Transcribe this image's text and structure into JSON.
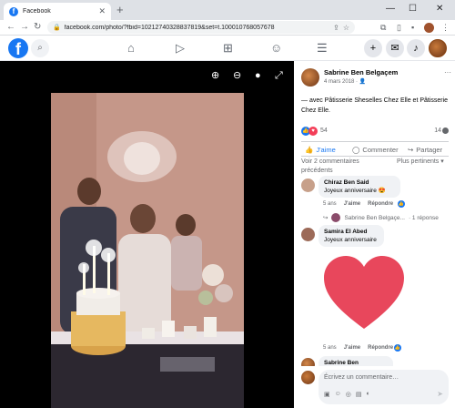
{
  "browser": {
    "tab_title": "Facebook",
    "tab_close": "✕",
    "new_tab": "+",
    "url": "facebook.com/photo/?fbid=10212740328837819&set=t.100010768057678",
    "minimize": "—",
    "maximize": "☐",
    "close": "✕"
  },
  "header": {
    "logo": "f",
    "nav_icons": [
      "home-icon",
      "watch-icon",
      "marketplace-icon",
      "groups-icon",
      "menu-icon"
    ]
  },
  "viewer": {
    "tools": [
      "zoom-in-icon",
      "zoom-out-icon",
      "tag-icon",
      "fullscreen-icon"
    ]
  },
  "post": {
    "author": "Sabrine Ben Belgaçem",
    "date": "4 mars 2018 · 👤",
    "more": "···",
    "text": "— avec Pâtisserie Sheselles Chez Elle et Pâtisserie Chez Elle.",
    "reaction_count": "54",
    "comment_count": "14",
    "actions": {
      "like": "J'aime",
      "comment": "Commenter",
      "share": "Partager"
    },
    "previous_comments": "Voir 2 commentaires précédents",
    "sort": "Plus pertinents ▾"
  },
  "comments": [
    {
      "name": "Chiraz Ben Said",
      "text": "Joyeux anniversaire 😍",
      "time": "5 ans",
      "like": "J'aime",
      "reply": "Répondre",
      "reply_author": "Sabrine Ben Belgaçe...",
      "reply_count": "· 1 réponse"
    },
    {
      "name": "Samira El Abed",
      "text": "Joyeux anniversaire",
      "time": "5 ans",
      "like": "J'aime",
      "reply": "Répondre"
    },
    {
      "name": "Sabrine Ben Belgaçem"
    }
  ],
  "composer": {
    "placeholder": "Écrivez un commentaire…"
  },
  "colors": {
    "brand": "#1877f2",
    "love": "#f33e58",
    "heart_sticker": "#e8475c"
  }
}
